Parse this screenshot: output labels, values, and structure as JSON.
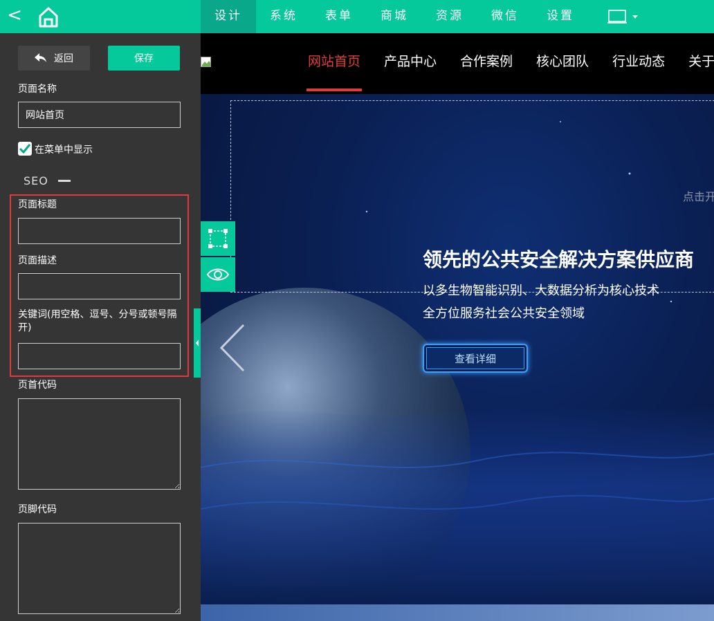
{
  "topbar": {
    "back_glyph": "<",
    "nav": [
      "设计",
      "系统",
      "表单",
      "商城",
      "资源",
      "微信",
      "设置"
    ]
  },
  "panel": {
    "return_label": "返回",
    "save_label": "保存",
    "page_name_label": "页面名称",
    "page_name_value": "网站首页",
    "show_in_menu_label": "在菜单中显示",
    "seo_label": "SEO",
    "page_title_label": "页面标题",
    "page_desc_label": "页面描述",
    "keywords_label": "关键词(用空格、逗号、分号或顿号隔开)",
    "header_code_label": "页首代码",
    "footer_code_label": "页脚代码"
  },
  "site": {
    "nav": [
      "网站首页",
      "产品中心",
      "合作案例",
      "核心团队",
      "行业动态",
      "关于"
    ],
    "click_hint": "点击开",
    "banner_title": "领先的公共安全解决方案供应商",
    "banner_sub1": "以多生物智能识别、大数据分析为核心技术",
    "banner_sub2": "全方位服务社会公共安全领域",
    "detail_button": "查看详细"
  },
  "colors": {
    "accent": "#05c99a",
    "panel_bg": "#353535",
    "highlight_red": "#e23a3a",
    "site_active": "#e33b3b"
  }
}
